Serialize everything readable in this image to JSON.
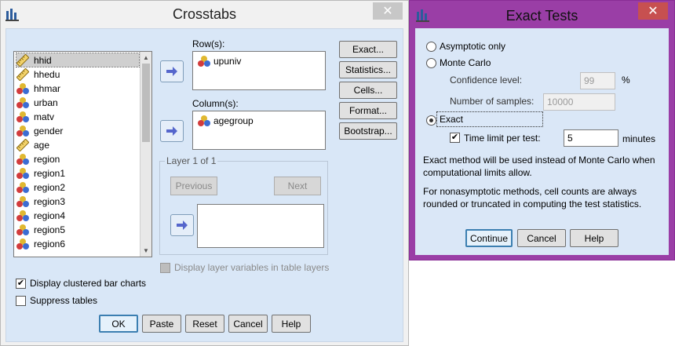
{
  "crosstabs": {
    "title": "Crosstabs",
    "variables": [
      {
        "name": "hhid",
        "type": "scale",
        "selected": true
      },
      {
        "name": "hhedu",
        "type": "scale"
      },
      {
        "name": "hhmar",
        "type": "nominal"
      },
      {
        "name": "urban",
        "type": "nominal"
      },
      {
        "name": "matv",
        "type": "nominal"
      },
      {
        "name": "gender",
        "type": "nominal"
      },
      {
        "name": "age",
        "type": "scale"
      },
      {
        "name": "region",
        "type": "nominal"
      },
      {
        "name": "region1",
        "type": "nominal"
      },
      {
        "name": "region2",
        "type": "nominal"
      },
      {
        "name": "region3",
        "type": "nominal"
      },
      {
        "name": "region4",
        "type": "nominal"
      },
      {
        "name": "region5",
        "type": "nominal"
      },
      {
        "name": "region6",
        "type": "nominal"
      }
    ],
    "rows_label": "Row(s):",
    "rows_value": "upuniv",
    "columns_label": "Column(s):",
    "columns_value": "agegroup",
    "layer_label": "Layer 1 of 1",
    "previous_label": "Previous",
    "next_label": "Next",
    "side_buttons": [
      "Exact...",
      "Statistics...",
      "Cells...",
      "Format...",
      "Bootstrap..."
    ],
    "display_layer_label": "Display layer variables in table layers",
    "display_clustered_label": "Display clustered bar charts",
    "display_clustered_checked": true,
    "suppress_tables_label": "Suppress tables",
    "suppress_tables_checked": false,
    "bottom_buttons": [
      "OK",
      "Paste",
      "Reset",
      "Cancel",
      "Help"
    ]
  },
  "exact_tests": {
    "title": "Exact Tests",
    "asymptotic_label": "Asymptotic only",
    "monte_carlo_label": "Monte Carlo",
    "confidence_label": "Confidence level:",
    "confidence_value": "99",
    "percent_sign": "%",
    "samples_label": "Number of samples:",
    "samples_value": "10000",
    "exact_label": "Exact",
    "selected_method": "Exact",
    "time_limit_label": "Time limit per test:",
    "time_limit_checked": true,
    "time_limit_value": "5",
    "minutes_label": "minutes",
    "note1": "Exact method will be used instead of Monte Carlo when computational limits allow.",
    "note2": "For nonasymptotic methods, cell counts are always rounded or truncated in computing the test statistics.",
    "buttons": [
      "Continue",
      "Cancel",
      "Help"
    ]
  },
  "colors": {
    "dialog_bg": "#d9e7f7",
    "exact_frame": "#9a3ea6",
    "close_red": "#c75050",
    "default_button_border": "#3c7fb1"
  }
}
